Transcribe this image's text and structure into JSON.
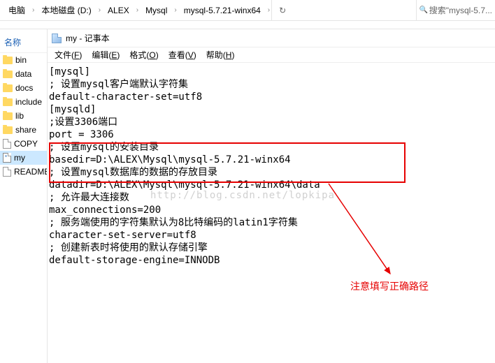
{
  "breadcrumb": {
    "items": [
      "电脑",
      "本地磁盘 (D:)",
      "ALEX",
      "Mysql",
      "mysql-5.7.21-winx64"
    ],
    "refresh": "↻",
    "search_placeholder": "搜索\"mysql-5.7..."
  },
  "sidebar": {
    "header": "名称",
    "items": [
      {
        "type": "folder",
        "label": "bin"
      },
      {
        "type": "folder",
        "label": "data"
      },
      {
        "type": "folder",
        "label": "docs"
      },
      {
        "type": "folder",
        "label": "include"
      },
      {
        "type": "folder",
        "label": "lib"
      },
      {
        "type": "folder",
        "label": "share"
      },
      {
        "type": "file",
        "label": "COPY"
      },
      {
        "type": "ini",
        "label": "my",
        "selected": true
      },
      {
        "type": "file",
        "label": "README"
      }
    ]
  },
  "notepad": {
    "title": "my - 记事本",
    "menus": [
      {
        "label": "文件",
        "hotkey": "F"
      },
      {
        "label": "编辑",
        "hotkey": "E"
      },
      {
        "label": "格式",
        "hotkey": "O"
      },
      {
        "label": "查看",
        "hotkey": "V"
      },
      {
        "label": "帮助",
        "hotkey": "H"
      }
    ],
    "content": "[mysql]\n; 设置mysql客户端默认字符集\ndefault-character-set=utf8\n[mysqld]\n;设置3306端口\nport = 3306\n; 设置mysql的安装目录\nbasedir=D:\\ALEX\\Mysql\\mysql-5.7.21-winx64\n; 设置mysql数据库的数据的存放目录\ndatadir=D:\\ALEX\\Mysql\\mysql-5.7.21-winx64\\data\n; 允许最大连接数\nmax_connections=200\n; 服务端使用的字符集默认为8比特编码的latin1字符集\ncharacter-set-server=utf8\n; 创建新表时将使用的默认存储引擎\ndefault-storage-engine=INNODB"
  },
  "annotation": {
    "text": "注意填写正确路径",
    "watermark": "http://blog.csdn.net/lopkipa"
  }
}
